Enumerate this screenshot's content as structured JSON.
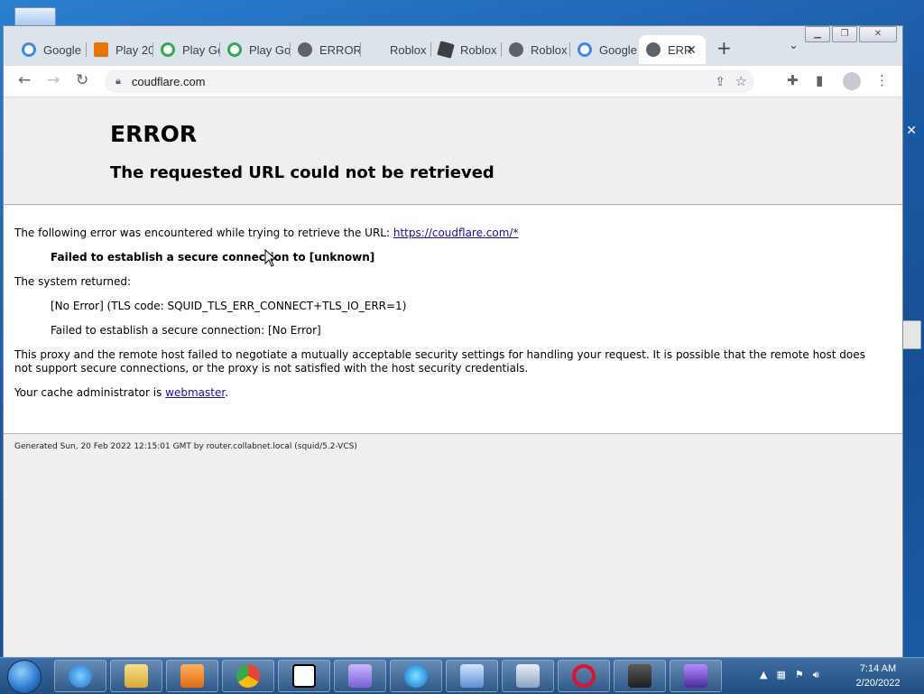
{
  "browser": {
    "tabs": [
      {
        "label": "Google",
        "icon": "google-icon",
        "color": "#4285f4"
      },
      {
        "label": "Play 20",
        "icon": "play-icon",
        "color": "#e37400"
      },
      {
        "label": "Play Go",
        "icon": "google-icon",
        "color": "#34a853"
      },
      {
        "label": "Play Go",
        "icon": "google-icon",
        "color": "#34a853"
      },
      {
        "label": "ERROR",
        "icon": "globe-icon",
        "color": "#5f6368"
      },
      {
        "label": "Roblox",
        "icon": "roblox-icon",
        "color": "#ffffff"
      },
      {
        "label": "Roblox",
        "icon": "roblox-icon",
        "color": "#3c4043"
      },
      {
        "label": "Roblox",
        "icon": "globe-icon",
        "color": "#5f6368"
      },
      {
        "label": "Google",
        "icon": "google-icon",
        "color": "#4285f4"
      },
      {
        "label": "ERR",
        "icon": "globe-icon",
        "color": "#5f6368",
        "active": true
      }
    ],
    "address": "coudflare.com"
  },
  "page": {
    "title": "ERROR",
    "subtitle": "The requested URL could not be retrieved",
    "intro": "The following error was encountered while trying to retrieve the URL: ",
    "url_link": "https://coudflare.com/*",
    "failure": "Failed to establish a secure connection to [unknown]",
    "system_returned": "The system returned:",
    "tls_code": "[No Error] (TLS code: SQUID_TLS_ERR_CONNECT+TLS_IO_ERR=1)",
    "failed_secure": "Failed to establish a secure connection: [No Error]",
    "explanation_1": "This proxy and the remote host failed to negotiate a mutually acceptable security settings for handling your request. It is possible that the remote host does",
    "explanation_2": "not support secure connections, or the proxy is not satisfied with the host security credentials.",
    "cache_admin": "Your cache administrator is ",
    "webmaster": "webmaster",
    "period": ".",
    "footer": "Generated Sun, 20 Feb 2022 12:15:01 GMT by router.collabnet.local (squid/5.2-VCS)"
  },
  "taskbar": {
    "time": "7:14 AM",
    "date": "2/20/2022",
    "apps": [
      "internet-explorer-icon",
      "file-explorer-icon",
      "media-player-icon",
      "chrome-icon",
      "7zip-icon",
      "app-icon",
      "edge-icon",
      "control-panel-icon",
      "remote-desktop-icon",
      "opera-icon",
      "terminal-icon",
      "game-icon"
    ]
  }
}
